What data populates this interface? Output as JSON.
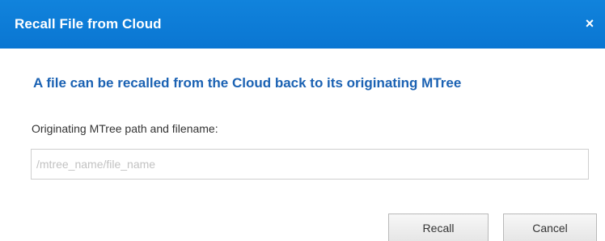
{
  "dialog": {
    "title": "Recall File from Cloud",
    "close_glyph": "×",
    "heading": "A file can be recalled from the Cloud back to its originating MTree",
    "path_field": {
      "label": "Originating MTree path and filename:",
      "value": "",
      "placeholder": "/mtree_name/file_name"
    },
    "buttons": {
      "recall_label": "Recall",
      "cancel_label": "Cancel"
    }
  },
  "colors": {
    "titlebar": "#0a78d4",
    "heading": "#1b62b3"
  },
  "icons": {
    "close": "close-icon"
  }
}
